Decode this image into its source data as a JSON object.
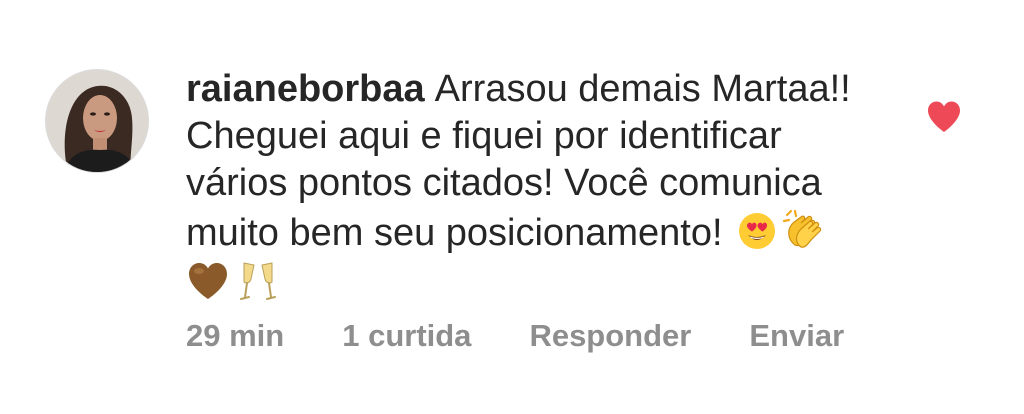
{
  "comment": {
    "username": "raianeborbaa",
    "text": "Arrasou demais Martaa!! Cheguei aqui e fiquei por identificar vários pontos citados! Você comunica muito bem seu posicionamento!",
    "emojis_inline": [
      "heart-eyes-emoji",
      "clapping-hands-emoji"
    ],
    "emojis_second_line": [
      "brown-heart-emoji",
      "champagne-glasses-emoji"
    ],
    "liked": true,
    "like_color": "#ed4956"
  },
  "meta": {
    "time": "29 min",
    "likes": "1 curtida",
    "reply": "Responder",
    "send": "Enviar"
  },
  "colors": {
    "text": "#262626",
    "secondary": "#8e8e8e"
  }
}
